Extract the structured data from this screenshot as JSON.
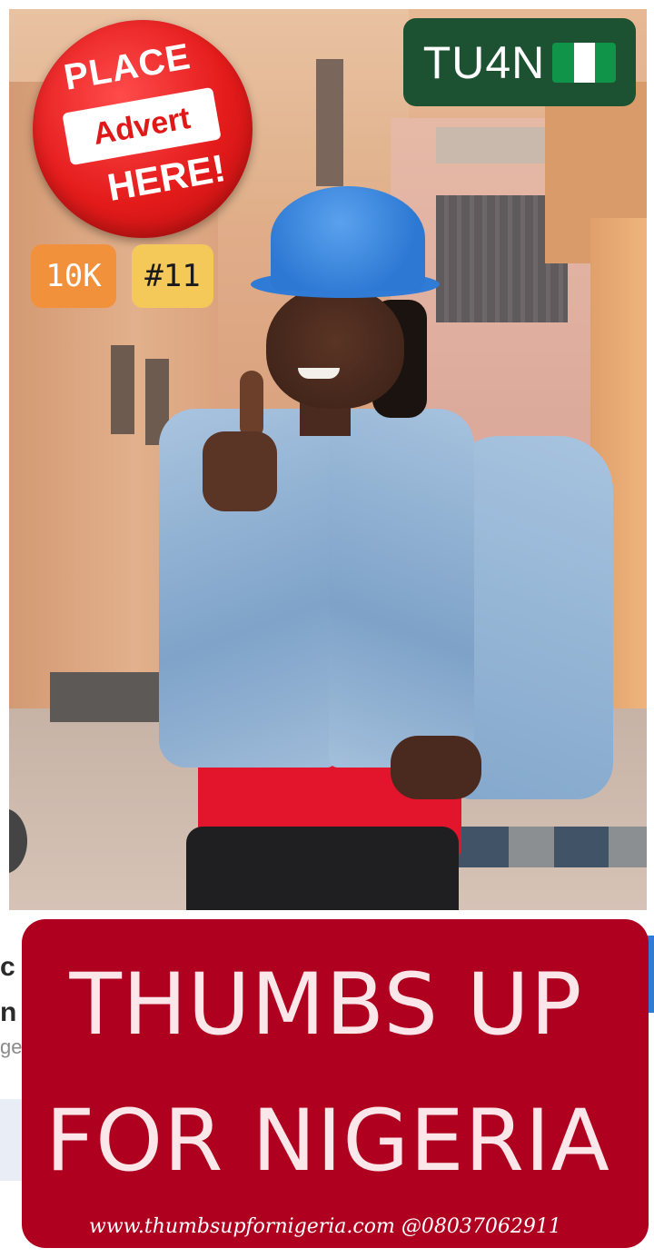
{
  "advert_badge": {
    "line1": "PLACE",
    "line2": "Advert",
    "line3": "HERE!"
  },
  "stats": {
    "views": "10K",
    "rank": "#11"
  },
  "brand": {
    "label": "TU4N",
    "flag_icon": "nigeria-flag-icon"
  },
  "background_card": {
    "line1": "c",
    "line2": "n",
    "line3": "ge"
  },
  "banner": {
    "title_line1": "THUMBS UP",
    "title_line2": "FOR NIGERIA",
    "website": "www.thumbsupfornigeria.com",
    "phone": "@08037062911"
  },
  "colors": {
    "banner_bg": "#b0001f",
    "advert_red": "#e41b1b",
    "brand_green": "#1c5232",
    "views_orange": "#f2913b",
    "rank_yellow": "#f5c85a"
  }
}
